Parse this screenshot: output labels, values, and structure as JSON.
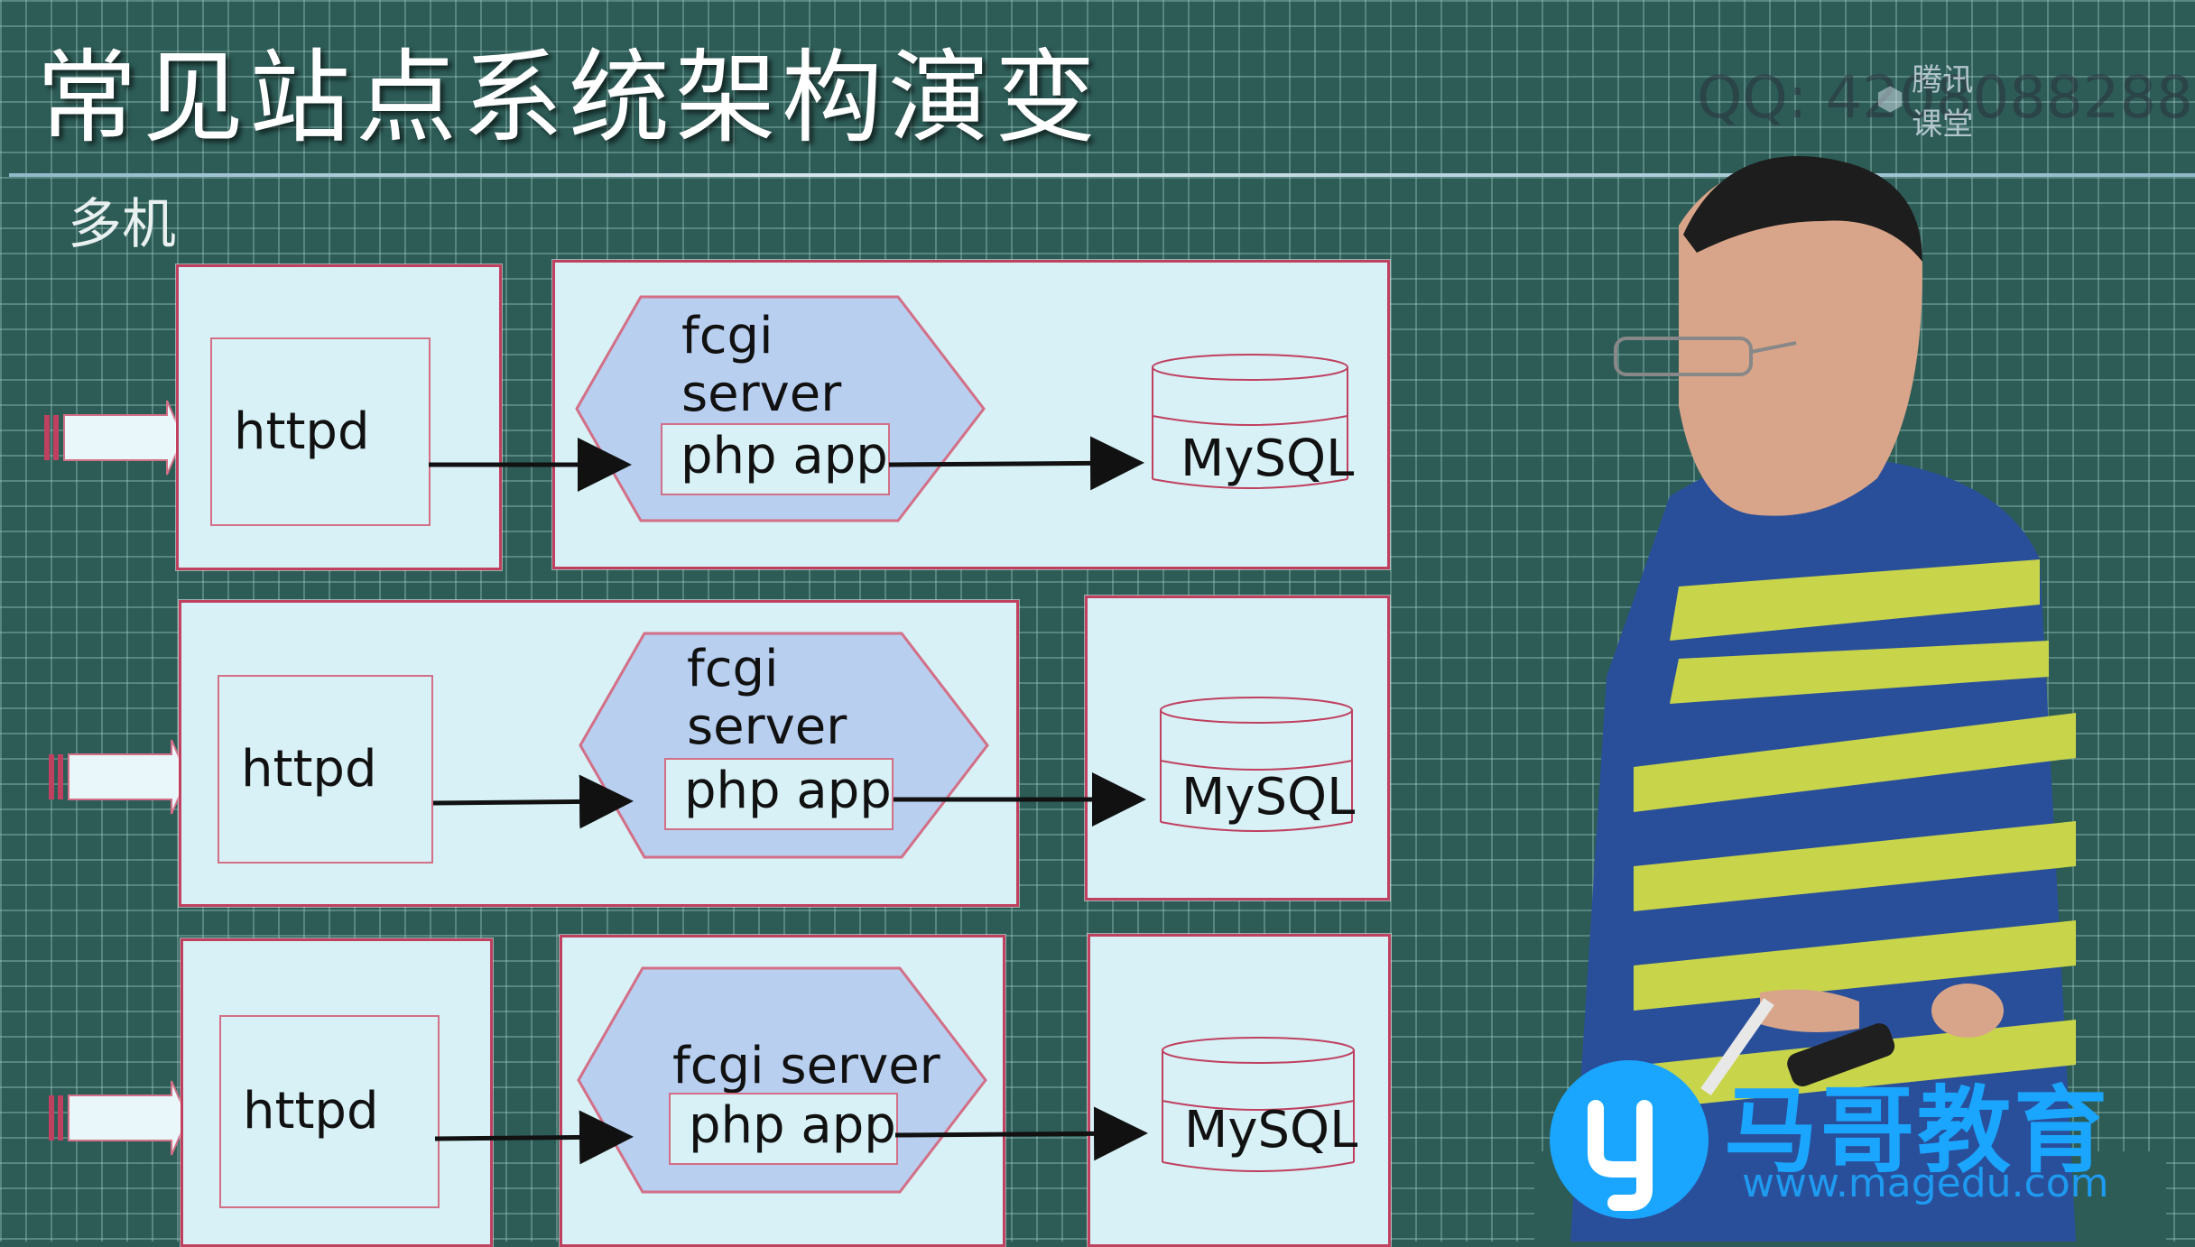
{
  "slide": {
    "title": "常见站点系统架构演变",
    "subtitle": "多机",
    "watermark_qq": "QQ: 4208088288",
    "watermark_platform": "腾讯课堂"
  },
  "rows": [
    {
      "httpd": "httpd",
      "fcgi": "fcgi server",
      "php": "php app",
      "mysql": "MySQL"
    },
    {
      "httpd": "httpd",
      "fcgi": "fcgi server",
      "php": "php app",
      "mysql": "MySQL"
    },
    {
      "httpd": "httpd",
      "fcgi": "fcgi server",
      "php": "php app",
      "mysql": "MySQL"
    }
  ],
  "logo": {
    "name": "马哥教育",
    "url": "www.magedu.com"
  },
  "colors": {
    "background": "#2d5c57",
    "box_fill": "#d7f1f6",
    "border": "#c04060",
    "hexagon": "#b8cff0",
    "logo": "#1aa6ff"
  }
}
